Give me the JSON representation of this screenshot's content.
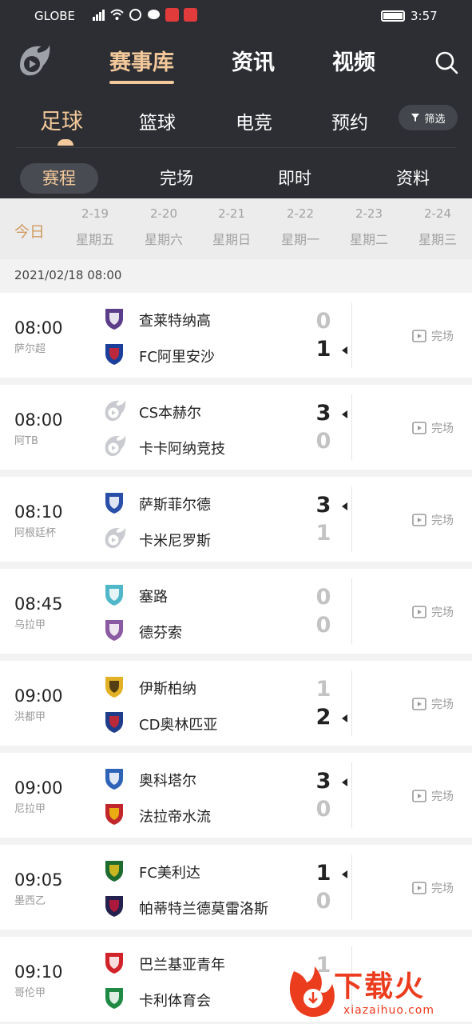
{
  "statusbar": {
    "carrier": "GLOBE",
    "network": "4G",
    "time": "3:57"
  },
  "topnav": {
    "items": [
      "赛事库",
      "资讯",
      "视频"
    ],
    "active": "赛事库"
  },
  "sportnav": {
    "items": [
      "足球",
      "篮球",
      "电竞",
      "预约"
    ],
    "active": "足球",
    "filter_label": "筛选"
  },
  "subtabs": {
    "items": [
      "赛程",
      "完场",
      "即时",
      "资料"
    ],
    "active": "赛程"
  },
  "datestrip": {
    "today_label": "今日",
    "days": [
      {
        "date": "2-19",
        "weekday": "星期五"
      },
      {
        "date": "2-20",
        "weekday": "星期六"
      },
      {
        "date": "2-21",
        "weekday": "星期日"
      },
      {
        "date": "2-22",
        "weekday": "星期一"
      },
      {
        "date": "2-23",
        "weekday": "星期二"
      },
      {
        "date": "2-24",
        "weekday": "星期三"
      }
    ]
  },
  "day_header": "2021/02/18 08:00",
  "colors": {
    "header_bg": "#2c2e33",
    "accent": "#f3c89a",
    "today": "#cf9a62",
    "watermark": "#ec3c1e"
  },
  "matches": [
    {
      "time": "08:00",
      "league": "萨尔超",
      "home": "查莱特纳高",
      "away": "FC阿里安沙",
      "home_score": "0",
      "away_score": "1",
      "status": "完场",
      "winner": "away",
      "home_icon": "shield-purple-icon",
      "away_icon": "badge-blue-a-icon"
    },
    {
      "time": "08:00",
      "league": "阿TB",
      "home": "CS本赫尔",
      "away": "卡卡阿纳竞技",
      "home_score": "3",
      "away_score": "0",
      "status": "完场",
      "winner": "home",
      "home_icon": "default-team-icon",
      "away_icon": "default-team-icon"
    },
    {
      "time": "08:10",
      "league": "阿根廷杯",
      "home": "萨斯菲尔德",
      "away": "卡米尼罗斯",
      "home_score": "3",
      "away_score": "1",
      "status": "完场",
      "winner": "home",
      "home_icon": "shield-blue-v-icon",
      "away_icon": "default-team-icon"
    },
    {
      "time": "08:45",
      "league": "乌拉甲",
      "home": "塞路",
      "away": "德芬索",
      "home_score": "0",
      "away_score": "0",
      "status": "完场",
      "winner": "none",
      "home_icon": "shield-teal-icon",
      "away_icon": "shield-violet-icon"
    },
    {
      "time": "09:00",
      "league": "洪都甲",
      "home": "伊斯柏纳",
      "away": "CD奥林匹亚",
      "home_score": "1",
      "away_score": "2",
      "status": "完场",
      "winner": "away",
      "home_icon": "shield-yellow-icon",
      "away_icon": "badge-red-blue-icon"
    },
    {
      "time": "09:00",
      "league": "尼拉甲",
      "home": "奥科塔尔",
      "away": "法拉帝水流",
      "home_score": "3",
      "away_score": "0",
      "status": "完场",
      "winner": "home",
      "home_icon": "shield-blue-white-icon",
      "away_icon": "shield-red-yellow-icon"
    },
    {
      "time": "09:05",
      "league": "墨西乙",
      "home": "FC美利达",
      "away": "帕蒂特兰德莫雷洛斯",
      "home_score": "1",
      "away_score": "0",
      "status": "完场",
      "winner": "home",
      "home_icon": "shield-green-yellow-icon",
      "away_icon": "shield-navy-icon"
    },
    {
      "time": "09:10",
      "league": "哥伦甲",
      "home": "巴兰基亚青年",
      "away": "卡利体育会",
      "home_score": "1",
      "away_score": "",
      "status": "",
      "winner": "none",
      "home_icon": "shield-red-stripe-icon",
      "away_icon": "shield-green-icon"
    }
  ],
  "watermark": {
    "text": "下载火",
    "url": "xiazaihuo.com"
  }
}
